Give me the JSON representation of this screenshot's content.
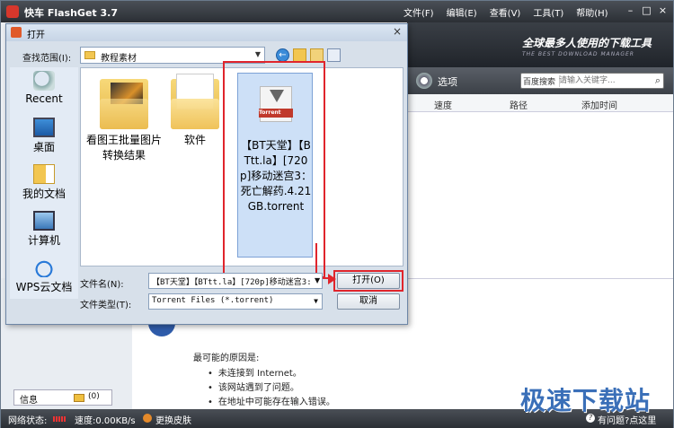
{
  "app": {
    "title": "快车 FlashGet 3.7",
    "menu": [
      "文件(F)",
      "编辑(E)",
      "查看(V)",
      "工具(T)",
      "帮助(H)"
    ],
    "slogan": "全球最多人使用的下载工具",
    "slogan_en": "THE BEST DOWNLOAD MANAGER",
    "options_label": "选项",
    "search_engine": "百度搜索",
    "search_placeholder": "请输入关键字...",
    "columns": [
      "速度",
      "路径",
      "添加时间"
    ]
  },
  "lower": {
    "reason_title": "最可能的原因是:",
    "reasons": [
      "未连接到 Internet。",
      "该网站遇到了问题。",
      "在地址中可能存在输入错误。"
    ]
  },
  "left": {
    "info_label": "信息",
    "info_count": "(0)"
  },
  "status": {
    "network": "网络状态:",
    "speed": "速度:0.00KB/s",
    "skin": "更换皮肤",
    "help": "有问题?点这里"
  },
  "watermark": "极速下载站",
  "dialog": {
    "title": "打开",
    "lookin_label": "查找范围(I):",
    "lookin_value": "教程素材",
    "places": [
      "Recent",
      "桌面",
      "我的文档",
      "计算机",
      "WPS云文档"
    ],
    "files": [
      {
        "name": "看图王批量图片转换结果"
      },
      {
        "name": "软件"
      }
    ],
    "torrent": {
      "tag": "Torrent",
      "name": "【BT天堂】【BTtt.la】[720p]移动迷宫3：死亡解药.4.21GB.torrent"
    },
    "filename_label": "文件名(N):",
    "filename_value": "【BT天堂】【BTtt.la】[720p]移动迷宫3:",
    "filetype_label": "文件类型(T):",
    "filetype_value": "Torrent Files (*.torrent)",
    "open_button": "打开(O)",
    "cancel_button": "取消"
  }
}
